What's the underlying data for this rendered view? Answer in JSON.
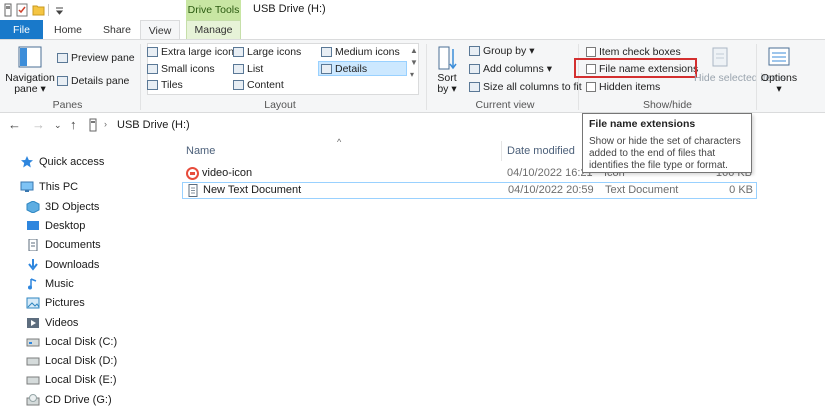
{
  "window": {
    "title": "USB Drive (H:)",
    "context_tab_label": "Drive Tools"
  },
  "tabs": [
    {
      "label": "File"
    },
    {
      "label": "Home"
    },
    {
      "label": "Share"
    },
    {
      "label": "View"
    },
    {
      "label": "Manage"
    }
  ],
  "ribbon": {
    "panes": {
      "navigation_pane": "Navigation pane",
      "preview_pane": "Preview pane",
      "details_pane": "Details pane",
      "group_label": "Panes"
    },
    "layout": {
      "extra_large_icons": "Extra large icons",
      "large_icons": "Large icons",
      "medium_icons": "Medium icons",
      "small_icons": "Small icons",
      "list": "List",
      "details": "Details",
      "tiles": "Tiles",
      "content": "Content",
      "group_label": "Layout"
    },
    "current_view": {
      "sort_by": "Sort by",
      "group_by": "Group by",
      "add_columns": "Add columns",
      "size_all_columns": "Size all columns to fit",
      "group_label": "Current view"
    },
    "show_hide": {
      "item_check_boxes": "Item check boxes",
      "file_name_extensions": "File name extensions",
      "hidden_items": "Hidden items",
      "hide_selected_items": "Hide selected items",
      "group_label": "Show/hide"
    },
    "options": {
      "label": "Options"
    }
  },
  "address": {
    "breadcrumb": "USB Drive (H:)"
  },
  "tooltip": {
    "title": "File name extensions",
    "body": "Show or hide the set of characters added to the end of files that identifies the file type or format."
  },
  "nav_pane": [
    {
      "label": "Quick access",
      "icon": "star-icon"
    },
    {
      "label": "This PC",
      "icon": "computer-icon"
    },
    {
      "label": "3D Objects",
      "icon": "cube-icon"
    },
    {
      "label": "Desktop",
      "icon": "desktop-icon"
    },
    {
      "label": "Documents",
      "icon": "documents-icon"
    },
    {
      "label": "Downloads",
      "icon": "download-icon"
    },
    {
      "label": "Music",
      "icon": "music-icon"
    },
    {
      "label": "Pictures",
      "icon": "pictures-icon"
    },
    {
      "label": "Videos",
      "icon": "videos-icon"
    },
    {
      "label": "Local Disk (C:)",
      "icon": "drive-icon"
    },
    {
      "label": "Local Disk (D:)",
      "icon": "drive-icon"
    },
    {
      "label": "Local Disk (E:)",
      "icon": "drive-icon"
    },
    {
      "label": "CD Drive (G:)",
      "icon": "cd-drive-icon"
    }
  ],
  "file_list": {
    "columns": {
      "name": "Name",
      "date_modified": "Date modified"
    },
    "rows": [
      {
        "name": "video-icon",
        "date": "04/10/2022 16:21",
        "type": "Icon",
        "size": "166 KB"
      },
      {
        "name": "New Text Document",
        "date": "04/10/2022 20:59",
        "type": "Text Document",
        "size": "0 KB"
      }
    ]
  },
  "colors": {
    "file_tab": "#1979ca",
    "drive_tools": "#c8e6a3",
    "highlight": "#d32f2f",
    "selection": "#cce8ff"
  }
}
